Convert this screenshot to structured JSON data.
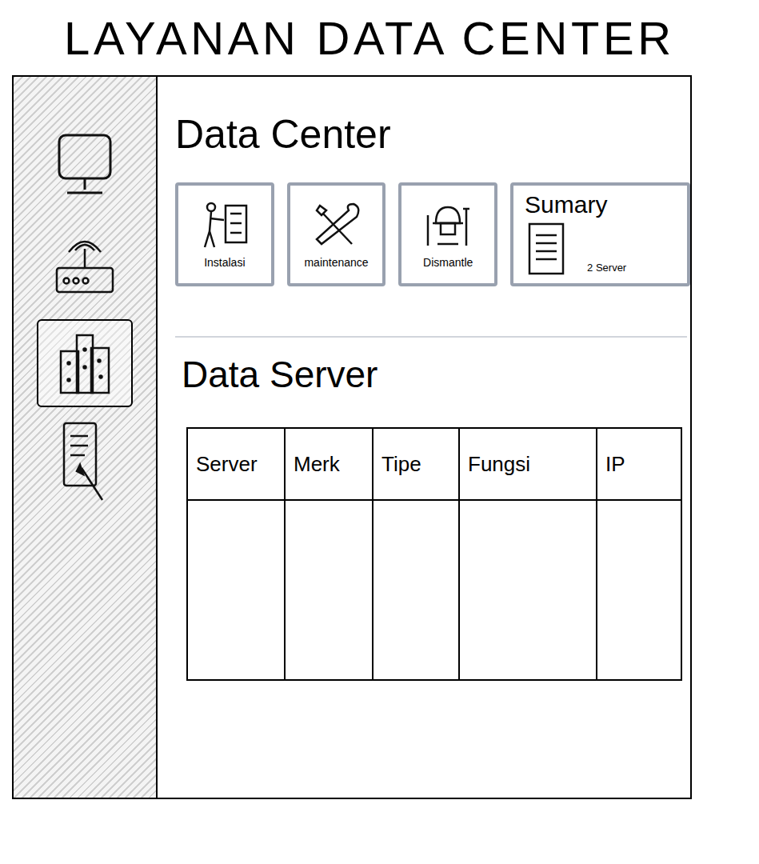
{
  "window": {
    "title": "LAYANAN DATA CENTER"
  },
  "sidebar": {
    "items": [
      {
        "selected": false
      },
      {
        "selected": false
      },
      {
        "selected": true
      },
      {
        "selected": false
      }
    ]
  },
  "main": {
    "heading": "Data Center"
  },
  "cards": [
    {
      "label": "Instalasi"
    },
    {
      "label": "maintenance"
    },
    {
      "label": "Dismantle"
    }
  ],
  "summary": {
    "title": "Sumary",
    "value": "2 Server"
  },
  "section": {
    "heading": "Data Server"
  },
  "table": {
    "columns": [
      "Server",
      "Merk",
      "Tipe",
      "Fungsi",
      "IP"
    ],
    "rows": []
  }
}
